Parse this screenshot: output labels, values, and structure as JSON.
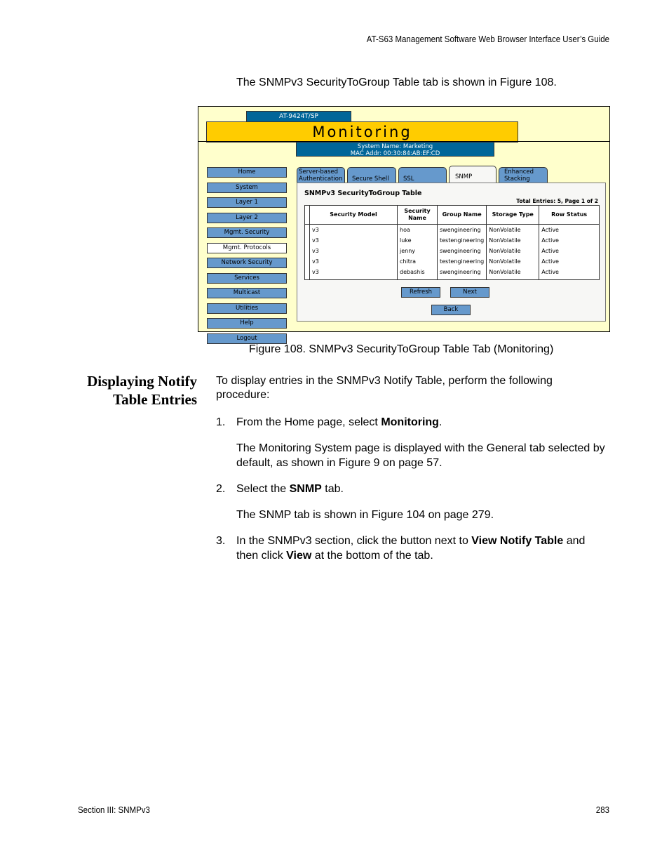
{
  "header": {
    "running_title": "AT-S63 Management Software Web Browser Interface User’s Guide"
  },
  "intro_text": "The SNMPv3 SecurityToGroup Table tab is shown in Figure 108.",
  "figure": {
    "model": "AT-9424T/SP",
    "banner": "Monitoring",
    "system_name": "System Name: Marketing",
    "mac_addr": "MAC Addr: 00:30:84:AB:EF:CD",
    "nav": [
      {
        "label": "Home",
        "active": false
      },
      {
        "label": "System",
        "active": false
      },
      {
        "label": "Layer 1",
        "active": false
      },
      {
        "label": "Layer 2",
        "active": false
      },
      {
        "label": "Mgmt. Security",
        "active": false
      },
      {
        "label": "Mgmt. Protocols",
        "active": true
      },
      {
        "label": "Network Security",
        "active": false
      },
      {
        "label": "Services",
        "active": false
      },
      {
        "label": "Multicast",
        "active": false
      },
      {
        "label": "Utilities",
        "active": false
      },
      {
        "label": "Help",
        "active": false
      },
      {
        "label": "Logout",
        "active": false
      }
    ],
    "tabs": [
      {
        "line1": "Server-based",
        "line2": "Authentication",
        "active": false
      },
      {
        "line1": "",
        "line2": "Secure Shell",
        "active": false
      },
      {
        "line1": "",
        "line2": "SSL",
        "active": false
      },
      {
        "line1": "",
        "line2": "SNMP",
        "active": true
      },
      {
        "line1": "Enhanced",
        "line2": "Stacking",
        "active": false
      }
    ],
    "panel_title": "SNMPv3 SecurityToGroup Table",
    "total_entries": "Total Entries: 5, Page 1 of 2",
    "columns": [
      "Security Model",
      "Security Name",
      "Group Name",
      "Storage Type",
      "Row Status"
    ],
    "rows": [
      [
        "v3",
        "hoa",
        "swengineering",
        "NonVolatile",
        "Active"
      ],
      [
        "v3",
        "luke",
        "testengineering",
        "NonVolatile",
        "Active"
      ],
      [
        "v3",
        "jenny",
        "swengineering",
        "NonVolatile",
        "Active"
      ],
      [
        "v3",
        "chitra",
        "testengineering",
        "NonVolatile",
        "Active"
      ],
      [
        "v3",
        "debashis",
        "swengineering",
        "NonVolatile",
        "Active"
      ]
    ],
    "buttons": {
      "refresh": "Refresh",
      "next": "Next",
      "back": "Back"
    },
    "colors": {
      "page_bg": "#ffffcc",
      "banner": "#ffcc00",
      "header_blue": "#006699",
      "button_blue": "#6699cc"
    }
  },
  "caption": "Figure 108. SNMPv3 SecurityToGroup Table Tab (Monitoring)",
  "section": {
    "heading_line1": "Displaying Notify",
    "heading_line2": "Table Entries",
    "intro": "To display entries in the SNMPv3 Notify Table, perform the following procedure:",
    "steps": [
      {
        "num": "1.",
        "pre": "From the Home page, select ",
        "bold": "Monitoring",
        "post": ".",
        "note": "The Monitoring System page is displayed with the General tab selected by default, as shown in Figure 9 on page 57."
      },
      {
        "num": "2.",
        "pre": "Select the ",
        "bold": "SNMP",
        "post": " tab.",
        "note": "The SNMP tab is shown in Figure 104 on page 279."
      },
      {
        "num": "3.",
        "pre": "In the SNMPv3 section, click the button next to ",
        "bold": "View Notify Table",
        "post": " and then click ",
        "bold2": "View",
        "post2": " at the bottom of the tab."
      }
    ]
  },
  "footer": {
    "section": "Section III: SNMPv3",
    "page": "283"
  }
}
